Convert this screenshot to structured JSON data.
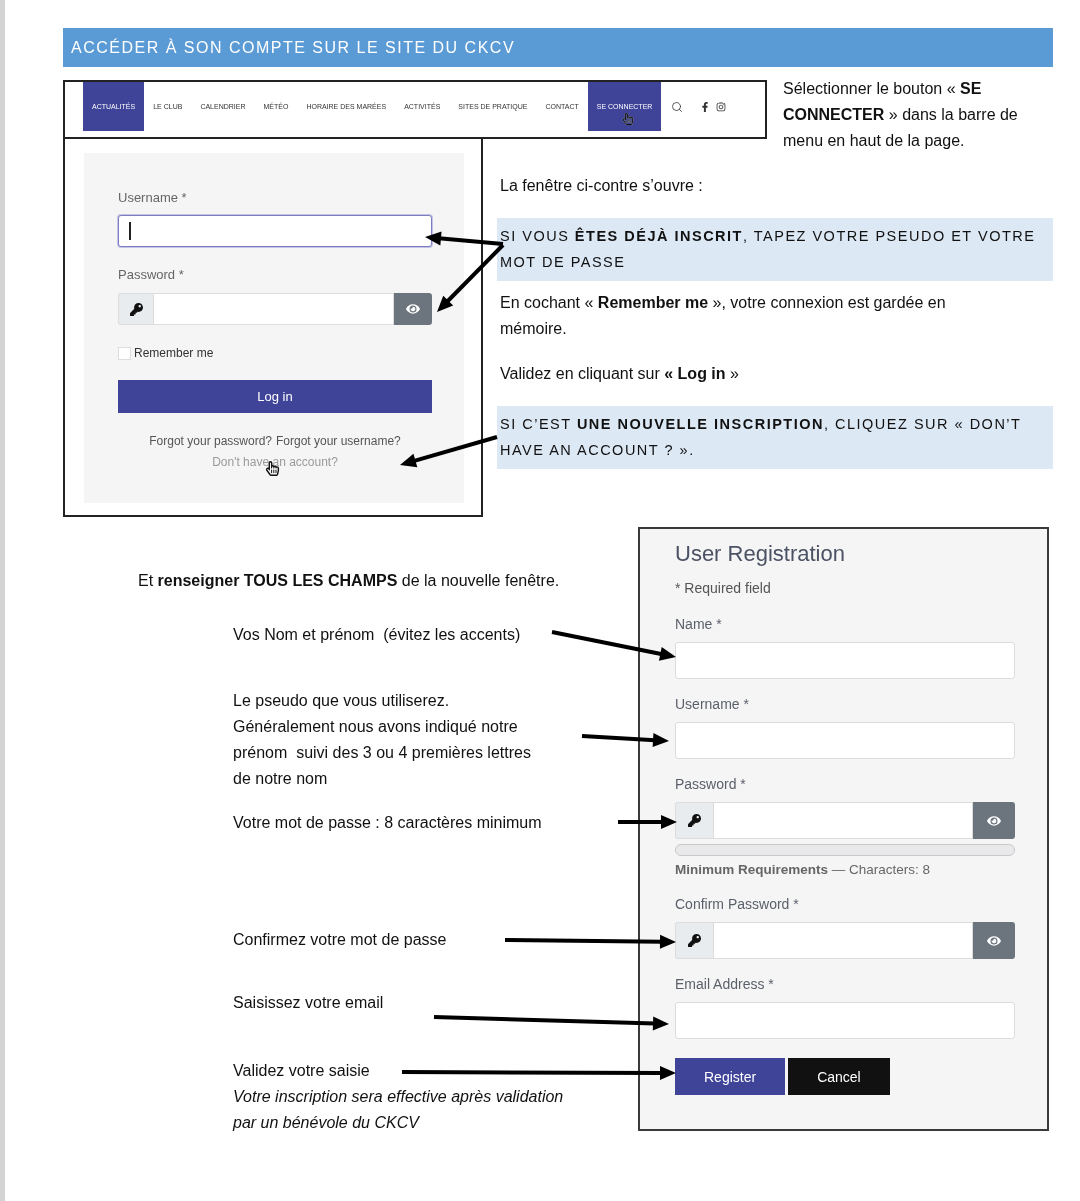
{
  "heading": "ACCÉDER À SON COMPTE SUR LE SITE DU CKCV",
  "site_menu": {
    "items": [
      {
        "label": "ACTUALITÉS",
        "highlighted": true,
        "hovered": false
      },
      {
        "label": "LE CLUB",
        "highlighted": false,
        "hovered": false
      },
      {
        "label": "CALENDRIER",
        "highlighted": false,
        "hovered": false
      },
      {
        "label": "MÉTÉO",
        "highlighted": false,
        "hovered": false
      },
      {
        "label": "HORAIRE DES MARÉES",
        "highlighted": false,
        "hovered": false
      },
      {
        "label": "ACTIVITÉS",
        "highlighted": false,
        "hovered": false
      },
      {
        "label": "SITES DE PRATIQUE",
        "highlighted": false,
        "hovered": false
      },
      {
        "label": "CONTACT",
        "highlighted": false,
        "hovered": false
      },
      {
        "label": "SE CONNECTER",
        "highlighted": true,
        "hovered": true
      }
    ]
  },
  "menu_instruction": "Sélectionner le bouton « **SE CONNECTER** » dans la barre de menu en haut de la page.",
  "login_form": {
    "fields": [
      {
        "label": "Username *",
        "kind": "text",
        "focused": true
      },
      {
        "label": "Password *",
        "kind": "password",
        "focused": false
      }
    ],
    "remember": {
      "label": "Remember me",
      "checked": false
    },
    "submit": "Log in",
    "links": [
      {
        "text": "Forgot your password?",
        "hovered": false
      },
      {
        "text": "Forgot your username?",
        "hovered": false
      },
      {
        "text": "Don't have an account?",
        "hovered": true
      }
    ]
  },
  "login_instructions": [
    {
      "kind": "plain",
      "text": "La fenêtre ci-contre s’ouvre :"
    },
    {
      "kind": "callout",
      "text": "SI VOUS **ÊTES DÉJÀ INSCRIT**, TAPEZ VOTRE PSEUDO ET VOTRE MOT DE PASSE"
    },
    {
      "kind": "plain",
      "text": "En cochant « **Remember me** », votre connexion est gardée en mémoire."
    },
    {
      "kind": "plain",
      "text": "Validez en cliquant sur **« Log in** »"
    },
    {
      "kind": "callout",
      "text": "SI C’EST **UNE NOUVELLE INSCRIPTION**, CLIQUEZ SUR « DON’T HAVE AN ACCOUNT ? »."
    }
  ],
  "registration_intro": "Et **renseigner TOUS LES CHAMPS** de la nouvelle fenêtre.",
  "registration_notes": [
    {
      "lines": [
        "Vos Nom et prénom  (évitez les accents)"
      ]
    },
    {
      "lines": [
        "Le pseudo que vous utiliserez.",
        "Généralement nous avons indiqué notre prénom  suivi des 3 ou 4 premières lettres de notre nom"
      ]
    },
    {
      "lines": [
        "Votre mot de passe : 8 caractères minimum"
      ]
    },
    {
      "lines": [
        "Confirmez votre mot de passe"
      ]
    },
    {
      "lines": [
        "Saisissez votre email"
      ]
    },
    {
      "lines": [
        "Validez votre saisie"
      ],
      "remark": "Votre inscription sera effective après validation par un bénévole du CKCV"
    }
  ],
  "registration_form": {
    "title": "User Registration",
    "required_note": "* Required field",
    "fields": [
      {
        "label": "Name *",
        "kind": "text"
      },
      {
        "label": "Username *",
        "kind": "text"
      },
      {
        "label": "Password *",
        "kind": "password",
        "strength": {
          "level": 0
        },
        "requirements": "**Minimum Requirements** — Characters: 8"
      },
      {
        "label": "Confirm Password *",
        "kind": "password"
      },
      {
        "label": "Email Address *",
        "kind": "text"
      }
    ],
    "buttons": [
      {
        "label": "Register",
        "kind": "primary"
      },
      {
        "label": "Cancel",
        "kind": "secondary"
      }
    ]
  }
}
